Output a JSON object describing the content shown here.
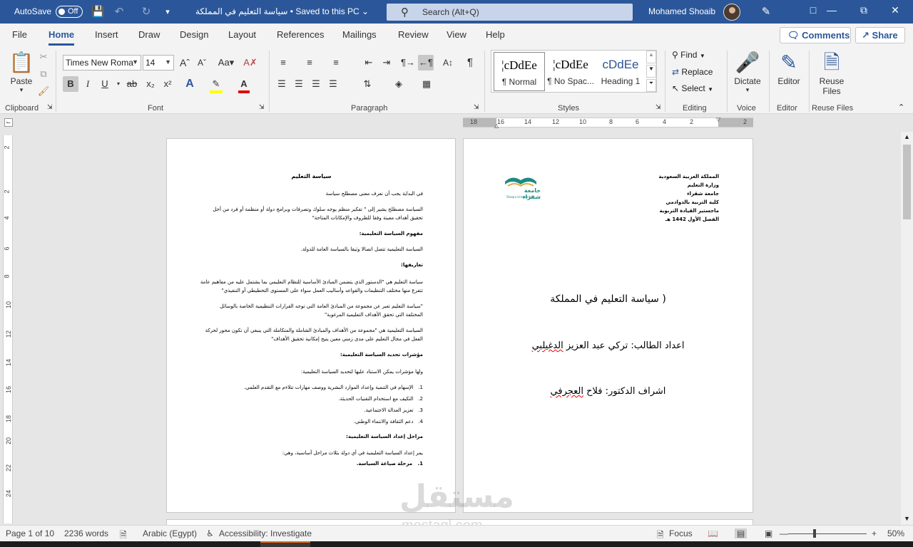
{
  "titlebar": {
    "autosave_label": "AutoSave",
    "autosave_state": "Off",
    "doc_title": "سياسة التعليم في المملكة • Saved to this PC",
    "search_placeholder": "Search (Alt+Q)",
    "user_name": "Mohamed Shoaib"
  },
  "tabs": [
    "File",
    "Home",
    "Insert",
    "Draw",
    "Design",
    "Layout",
    "References",
    "Mailings",
    "Review",
    "View",
    "Help"
  ],
  "active_tab": "Home",
  "actions": {
    "comments": "Comments",
    "share": "Share"
  },
  "ribbon": {
    "clipboard": {
      "paste": "Paste",
      "label": "Clipboard"
    },
    "font": {
      "family": "Times New Roma",
      "size": "14",
      "label": "Font"
    },
    "paragraph": {
      "label": "Paragraph"
    },
    "styles": {
      "label": "Styles",
      "items": [
        {
          "sample": "¦cDdEe",
          "name": "¶ Normal"
        },
        {
          "sample": "¦cDdEe",
          "name": "¶ No Spac..."
        },
        {
          "sample": "cDdEe",
          "name": "Heading 1"
        }
      ]
    },
    "editing": {
      "find": "Find",
      "replace": "Replace",
      "select": "Select",
      "label": "Editing"
    },
    "voice": {
      "dictate": "Dictate",
      "label": "Voice"
    },
    "editor": {
      "button": "Editor",
      "label": "Editor"
    },
    "reuse": {
      "button_line1": "Reuse",
      "button_line2": "Files",
      "label": "Reuse Files"
    }
  },
  "ruler": {
    "horizontal": [
      "18",
      "16",
      "14",
      "12",
      "10",
      "8",
      "6",
      "4",
      "2",
      "2"
    ],
    "vertical": [
      "2",
      "2",
      "4",
      "6",
      "8",
      "10",
      "12",
      "14",
      "16",
      "18",
      "20",
      "22",
      "24"
    ]
  },
  "page_left": {
    "title": "سياسة التعليم",
    "lines": [
      "في البداية يجب أن نعرف معنى مصطلح سياسة",
      "السياسة مصطلح يشير إلى \" تفكير منظم يوجه سلوك وتصرفات وبرامج دولة أو منظمة أو فرد من أجل",
      "تحقيق أهداف معينة وفقا للظروف والإمكانات المتاحة\"",
      "مفهوم السياسة التعليمية:",
      "السياسة التعليمية تتصل اتصالا وثيقا بالسياسة العامة للدولة.",
      "تعاريفها:",
      "سياسة التعليم هي \"الدستور الذي يتضمن المبادئ الأساسية للنظام التعليمي بما يشتمل عليه من مفاهيم عامة",
      "تتفرع منها مختلف التنظيمات والقواعد وأساليب العمل سواء على المستوى التخطيطي أو التنفيذي\"",
      "\"سياسة التعليم تعبر عن مجموعة من المبادئ العامة التي توجه القرارات التنظيمية الخاصة بالوسائل",
      "المختلفة التي تحقق الأهداف التعليمية المرغوبة\"",
      "السياسة التعليمية هي \"مجموعة من الأهداف والمبادئ الشاملة والمتكاملة التي ينبغي أن تكون محور لحركة",
      "الفعل في مجال التعليم على مدى زمني معين يتيح إمكانية تحقيق الأهداف\"",
      "مؤشرات تحديد السياسة التعليمية:",
      "ولها مؤشرات يمكن الاستناد عليها لتحديد السياسة التعليمية:",
      "الإسهام في التنمية وإعداد الموارد البشرية ووصف مهارات تتلاءم مع التقدم العلمي.",
      "التكيف مع استخدام التقنيات الحديثة.",
      "تعزيز العدالة الاجتماعية.",
      "دعم الثقافة والانتماء الوطني.",
      "مراحل إعداد السياسة التعليمية:",
      "يمر إعداد السياسة التعليمية في أي دولة بثلاث مراحل أساسية، وهي:",
      "مرحلة صياغة السياسة."
    ],
    "list_nums": [
      "1.",
      "2.",
      "3.",
      "4.",
      "1."
    ]
  },
  "page_right": {
    "header": [
      "المملكة العربية السعودية",
      "وزارة التعليم",
      "جامعة شقراء",
      "كلية التربية بالدوادمي",
      "ماجستير القيادة التربوية",
      "الفصل الأول 1442 هـ"
    ],
    "logo_text": "جامعة شقراء",
    "logo_sub": "Shaqra University",
    "title": "( سياسة التعليم في المملكة",
    "student_prefix": "اعداد الطالب: تركي عبد العزيز ",
    "student_name": "الدغيلبي",
    "supervisor_prefix": "اشراف الدكتور: فلاح ",
    "supervisor_name": "العجرفي"
  },
  "watermark": {
    "ar": "مستقل",
    "en": "mostaql.com"
  },
  "status": {
    "page": "Page 1 of 10",
    "words": "2236 words",
    "language": "Arabic (Egypt)",
    "accessibility": "Accessibility: Investigate",
    "focus": "Focus",
    "zoom": "50%"
  },
  "colors": {
    "accent": "#2b579a",
    "ribbon_bg": "#f3f3f3",
    "canvas": "#e6e6e6"
  }
}
